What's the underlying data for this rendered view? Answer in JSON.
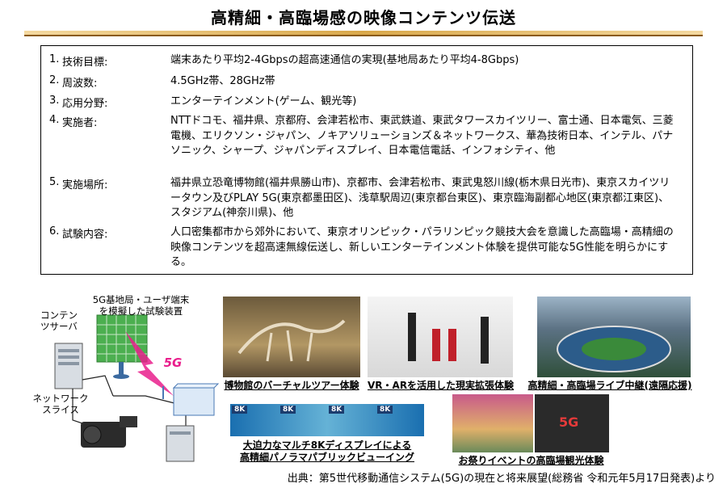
{
  "header": {
    "title": "高精細・高臨場感の映像コンテンツ伝送"
  },
  "spec": [
    {
      "num": "1.",
      "label": "技術目標:",
      "value": "端末あたり平均2-4Gbpsの超高速通信の実現(基地局あたり平均4-8Gbps)"
    },
    {
      "num": "2.",
      "label": "周波数:",
      "value": "4.5GHz帯、28GHz帯"
    },
    {
      "num": "3.",
      "label": "応用分野:",
      "value": "エンターテインメント(ゲーム、観光等)"
    },
    {
      "num": "4.",
      "label": "実施者:",
      "value": "NTTドコモ、福井県、京都府、会津若松市、東武鉄道、東武タワースカイツリー、富士通、日本電気、三菱電機、エリクソン・ジャパン、ノキアソリューションズ＆ネットワークス、華為技術日本、インテル、パナソニック、シャープ、ジャパンディスプレイ、日本電信電話、インフォシティ、他"
    },
    {
      "num": "5.",
      "label": "実施場所:",
      "value": "福井県立恐竜博物館(福井県勝山市)、京都市、会津若松市、東武鬼怒川線(栃木県日光市)、東京スカイツリータウン及びPLAY 5G(東京都墨田区)、浅草駅周辺(東京都台東区)、東京臨海副都心地区(東京都江東区)、スタジアム(神奈川県)、他"
    },
    {
      "num": "6.",
      "label": "試験内容:",
      "value": "人口密集都市から郊外において、東京オリンピック・パラリンピック競技大会を意識した高臨場・高精細の映像コンテンツを超高速無線伝送し、新しいエンターテインメント体験を提供可能な5G性能を明らかにする。"
    }
  ],
  "diagram": {
    "content_server": "コンテンツサーバ",
    "test_device": "5G基地局・ユーザ端末を模擬した試験装置",
    "network_slice": "ネットワークスライス",
    "label_5g": "5G"
  },
  "photos": {
    "museum": "博物館のバーチャルツアー体験",
    "vr_ar": "VR・ARを活用した現実拡張体験",
    "stadium": "高精細・高臨場ライブ中継(遠隔応援)",
    "multi8k_line1": "大迫力なマルチ8Kディスプレイによる",
    "multi8k_line2": "高精細パノラマパブリックビューイング",
    "festival": "お祭りイベントの高臨場観光体験",
    "tag_8k": "8K",
    "tag_5g": "5G"
  },
  "footer": {
    "source": "出典：第5世代移動通信システム(5G)の現在と将来展望(総務省 令和元年5月17日発表)より"
  }
}
